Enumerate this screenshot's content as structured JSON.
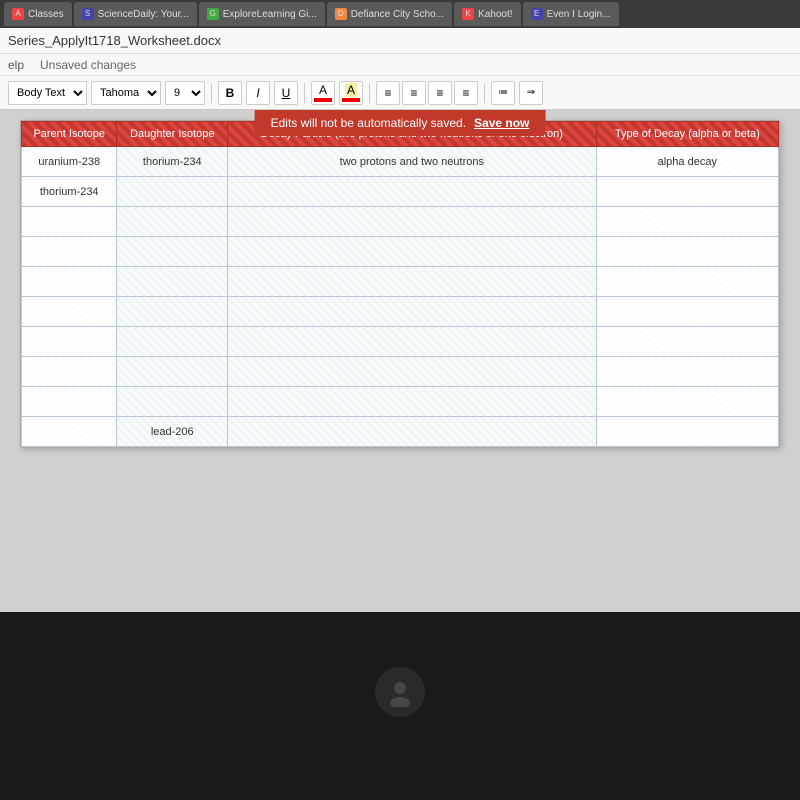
{
  "browser": {
    "tabs": [
      {
        "label": "Classes",
        "favicon": "red",
        "active": false
      },
      {
        "label": "ScienceDaily: Your...",
        "favicon": "blue",
        "active": false
      },
      {
        "label": "ExploreLearning Gi...",
        "favicon": "green",
        "active": false
      },
      {
        "label": "Defiance City Scho...",
        "favicon": "orange",
        "active": false
      },
      {
        "label": "Kahoot!",
        "favicon": "red",
        "active": false
      },
      {
        "label": "Even I Login...",
        "favicon": "blue",
        "active": false
      }
    ]
  },
  "title_bar": {
    "filename": "Series_ApplyIt1718_Worksheet.docx"
  },
  "notification": {
    "message": "Edits will not be automatically saved.",
    "save_label": "Save now"
  },
  "menu": {
    "help_label": "elp",
    "status_label": "Unsaved changes"
  },
  "toolbar": {
    "style_label": "Body Text",
    "font_label": "Tahoma",
    "size_label": "9",
    "bold_label": "B",
    "italic_label": "I",
    "underline_label": "U",
    "font_color_label": "A",
    "highlight_label": "A"
  },
  "table": {
    "headers": [
      "Parent Isotope",
      "Daughter Isotope",
      "Decay Particle (two protons and two neutrons or one electron)",
      "Type of Decay (alpha or beta)"
    ],
    "rows": [
      [
        "uranium-238",
        "thorium-234",
        "two protons and two neutrons",
        "alpha decay"
      ],
      [
        "thorium-234",
        "",
        "",
        ""
      ],
      [
        "",
        "",
        "",
        ""
      ],
      [
        "",
        "",
        "",
        ""
      ],
      [
        "",
        "",
        "",
        ""
      ],
      [
        "",
        "",
        "",
        ""
      ],
      [
        "",
        "",
        "",
        ""
      ],
      [
        "",
        "",
        "",
        ""
      ],
      [
        "",
        "",
        "",
        ""
      ],
      [
        "",
        "lead-206",
        "",
        ""
      ]
    ]
  }
}
